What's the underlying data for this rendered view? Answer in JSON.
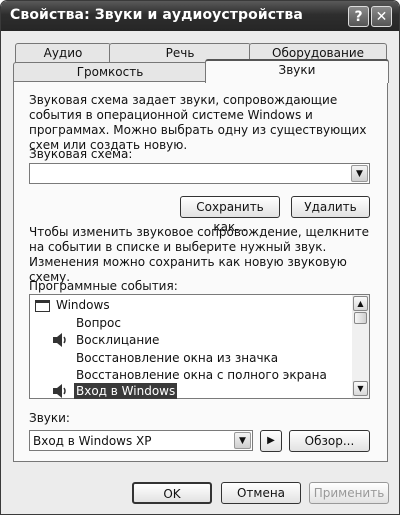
{
  "window": {
    "title": "Свойства: Звуки и аудиоустройства",
    "help_button": "?",
    "close_button": "✕"
  },
  "tabs": {
    "back_row": [
      "Аудио",
      "Речь",
      "Оборудование"
    ],
    "front_row": [
      "Громкость",
      "Звуки"
    ],
    "active": "Звуки"
  },
  "sounds": {
    "intro_text": "Звуковая схема задает звуки, сопровождающие события в операционной системе Windows и программах. Можно выбрать одну из существующих схем или создать новую.",
    "scheme_label": "Звуковая схема:",
    "scheme_value": "",
    "save_as_button": "Сохранить как...",
    "delete_button": "Удалить",
    "change_text": "Чтобы изменить звуковое сопровождение, щелкните на событии в списке и выберите нужный звук. Изменения можно сохранить как новую звуковую схему.",
    "events_label": "Программные события:",
    "events": [
      {
        "label": "Windows",
        "icon": "windows-window-icon",
        "level": 0
      },
      {
        "label": "Вопрос",
        "icon": "",
        "level": 1
      },
      {
        "label": "Восклицание",
        "icon": "speaker-icon",
        "level": 1
      },
      {
        "label": "Восстановление окна из значка",
        "icon": "",
        "level": 1
      },
      {
        "label": "Восстановление окна с полного экрана",
        "icon": "",
        "level": 1
      },
      {
        "label": "Вход в Windows",
        "icon": "speaker-icon",
        "level": 1,
        "selected": true
      }
    ],
    "sounds_label": "Звуки:",
    "sound_value": "Вход в Windows XP",
    "play_button": "▶",
    "browse_button": "Обзор..."
  },
  "footer": {
    "ok_button": "OK",
    "cancel_button": "Отмена",
    "apply_button": "Применить"
  }
}
